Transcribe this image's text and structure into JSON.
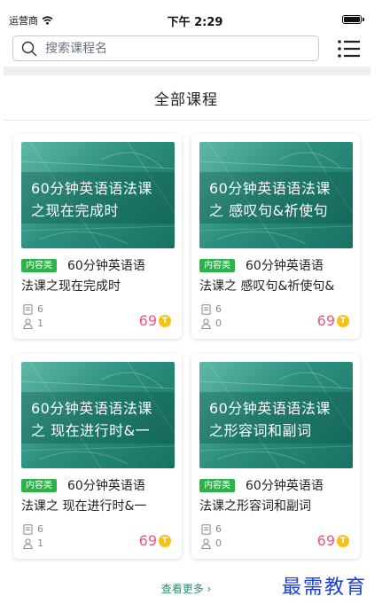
{
  "status_bar": {
    "carrier": "运营商",
    "time": "下午 2:29",
    "icons": [
      "wifi-icon",
      "battery-icon"
    ]
  },
  "search": {
    "placeholder": "搜索课程名",
    "icon": "search-icon",
    "menu_icon": "list-menu-icon"
  },
  "section": {
    "title": "全部课程"
  },
  "courses": [
    {
      "thumb_line1": "60分钟英语语法课",
      "thumb_line2": "之现在完成时",
      "tag": "内容类",
      "title_line1": "60分钟英语语",
      "title_line2": "法课之现在完成时",
      "lessons": "6",
      "students": "1",
      "price": "69"
    },
    {
      "thumb_line1": "60分钟英语语法课",
      "thumb_line2": "之 感叹句&祈使句",
      "tag": "内容类",
      "title_line1": "60分钟英语语",
      "title_line2": "法课之 感叹句&祈使句&",
      "lessons": "6",
      "students": "0",
      "price": "69"
    },
    {
      "thumb_line1": "60分钟英语语法课",
      "thumb_line2": "之 现在进行时&一",
      "tag": "内容类",
      "title_line1": "60分钟英语语",
      "title_line2": "法课之 现在进行时&一",
      "lessons": "6",
      "students": "1",
      "price": "69"
    },
    {
      "thumb_line1": "60分钟英语语法课",
      "thumb_line2": "之形容词和副词",
      "tag": "内容类",
      "title_line1": "60分钟英语语",
      "title_line2": "法课之形容词和副词",
      "lessons": "6",
      "students": "0",
      "price": "69"
    }
  ],
  "coin_symbol": "T",
  "more_link": "查看更多 ›",
  "watermark": "最需教育",
  "colors": {
    "tag_green": "#2db24a",
    "price_pink": "#f0577a",
    "coin_gold": "#f5c116",
    "more_link_green": "#2b8a6e",
    "watermark_blue": "#1b3fd6",
    "thumb_teal": "#2c8f7e"
  }
}
